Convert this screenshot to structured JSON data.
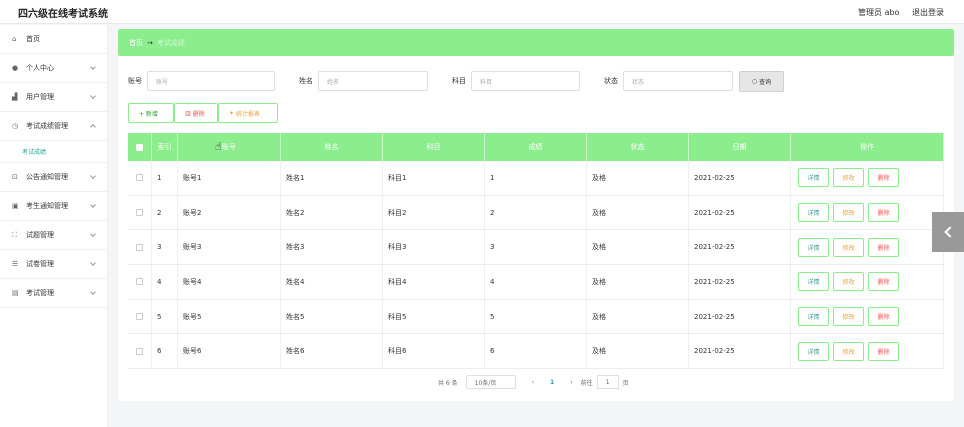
{
  "header": {
    "title": "四六级在线考试系统",
    "user": "管理员 abo",
    "logout": "退出登录"
  },
  "sidebar": {
    "items": [
      {
        "label": "首页",
        "icon": "home-icon"
      },
      {
        "label": "个人中心",
        "icon": "user-icon"
      },
      {
        "label": "用户管理",
        "icon": "chart-icon"
      },
      {
        "label": "考试成绩管理",
        "icon": "clock-icon"
      },
      {
        "label": "公告通知管理",
        "icon": "crop-icon"
      },
      {
        "label": "考生通知管理",
        "icon": "image-icon"
      },
      {
        "label": "试题管理",
        "icon": "expand-icon"
      },
      {
        "label": "试卷管理",
        "icon": "stack-icon"
      },
      {
        "label": "考试管理",
        "icon": "monitor-icon"
      }
    ],
    "sub_active": "考试成绩"
  },
  "breadcrumb": {
    "home": "首页",
    "arrow": "→",
    "current": "考试成绩"
  },
  "search": {
    "labels": [
      "账号",
      "姓名",
      "科目",
      "状态"
    ],
    "placeholders": [
      "账号",
      "姓名",
      "科目",
      "状态"
    ],
    "query_label": "查询"
  },
  "actions": {
    "add": "+ 新增",
    "delete": "删除",
    "stats": "统计报表"
  },
  "table": {
    "headers": [
      "索引",
      "账号",
      "姓名",
      "科目",
      "成绩",
      "状态",
      "日期",
      "操作"
    ],
    "rows": [
      {
        "idx": "1",
        "account": "账号1",
        "name": "姓名1",
        "subject": "科目1",
        "score": "1",
        "status": "及格",
        "date": "2021-02-25"
      },
      {
        "idx": "2",
        "account": "账号2",
        "name": "姓名2",
        "subject": "科目2",
        "score": "2",
        "status": "及格",
        "date": "2021-02-25"
      },
      {
        "idx": "3",
        "account": "账号3",
        "name": "姓名3",
        "subject": "科目3",
        "score": "3",
        "status": "及格",
        "date": "2021-02-25"
      },
      {
        "idx": "4",
        "account": "账号4",
        "name": "姓名4",
        "subject": "科目4",
        "score": "4",
        "status": "及格",
        "date": "2021-02-25"
      },
      {
        "idx": "5",
        "account": "账号5",
        "name": "姓名5",
        "subject": "科目5",
        "score": "5",
        "status": "及格",
        "date": "2021-02-25"
      },
      {
        "idx": "6",
        "account": "账号6",
        "name": "姓名6",
        "subject": "科目6",
        "score": "6",
        "status": "及格",
        "date": "2021-02-25"
      }
    ],
    "op_detail": "详情",
    "op_edit": "修改",
    "op_delete": "删除"
  },
  "pager": {
    "total": "共 6 条",
    "page_size": "10条/页",
    "current": "1",
    "goto_label": "前往",
    "goto_value": "1",
    "page_suffix": "页"
  },
  "colors": {
    "accent": "#8ced8c",
    "link": "#2aa0a0"
  }
}
